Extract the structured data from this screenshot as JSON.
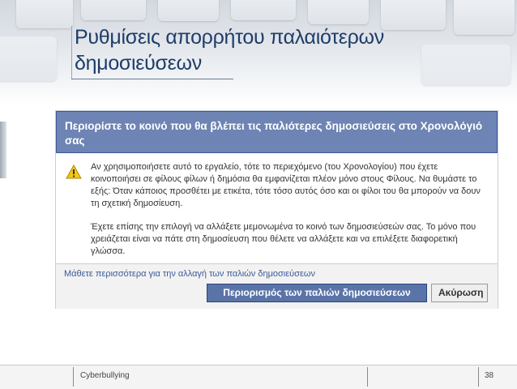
{
  "slide": {
    "title": "Ρυθμίσεις απορρήτου παλαιότερων δημοσιεύσεων",
    "footer_text": "Cyberbullying",
    "page_number": "38"
  },
  "dialog": {
    "title": "Περιορίστε το κοινό που θα βλέπει τις παλιότερες δημοσιεύσεις στο Χρονολόγιό σας",
    "paragraph_1": "Αν χρησιμοποιήσετε αυτό το εργαλείο, τότε το περιεχόμενο (του Χρονολογίου) που έχετε κοινοποιήσει σε φίλους φίλων ή δημόσια θα εμφανίζεται πλέον μόνο στους Φίλους. Να θυμάστε το εξής: Όταν κάποιος προσθέτει με ετικέτα, τότε τόσο αυτός όσο και οι φίλοι του θα μπορούν να δουν τη σχετική δημοσίευση.",
    "paragraph_2": "Έχετε επίσης την επιλογή να αλλάξετε μεμονωμένα το κοινό των δημοσιεύσεών σας. Το μόνο που χρειάζεται είναι να πάτε στη δημοσίευση που θέλετε να αλλάξετε και να επιλέξετε διαφορετική γλώσσα.",
    "learn_more_link": "Μάθετε περισσότερα για την αλλαγή των παλιών δημοσιεύσεων",
    "primary_button": "Περιορισμός των παλιών δημοσιεύσεων",
    "cancel_button": "Ακύρωση",
    "warning_icon": "warning-triangle-icon"
  },
  "colors": {
    "title": "#1e3d68",
    "dialog_header": "#6d84b4",
    "link": "#3b5998",
    "primary_button": "#5b74a8"
  }
}
